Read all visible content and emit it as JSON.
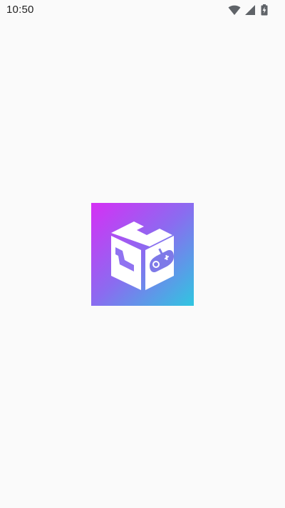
{
  "status_bar": {
    "time": "10:50",
    "icons": [
      "wifi-icon",
      "signal-icon",
      "battery-charging-icon"
    ]
  },
  "splash": {
    "logo_icon": "game-cube-controller-icon",
    "gradient_colors": [
      "#d62ff5",
      "#8a6cf0",
      "#2fc6e0"
    ]
  }
}
